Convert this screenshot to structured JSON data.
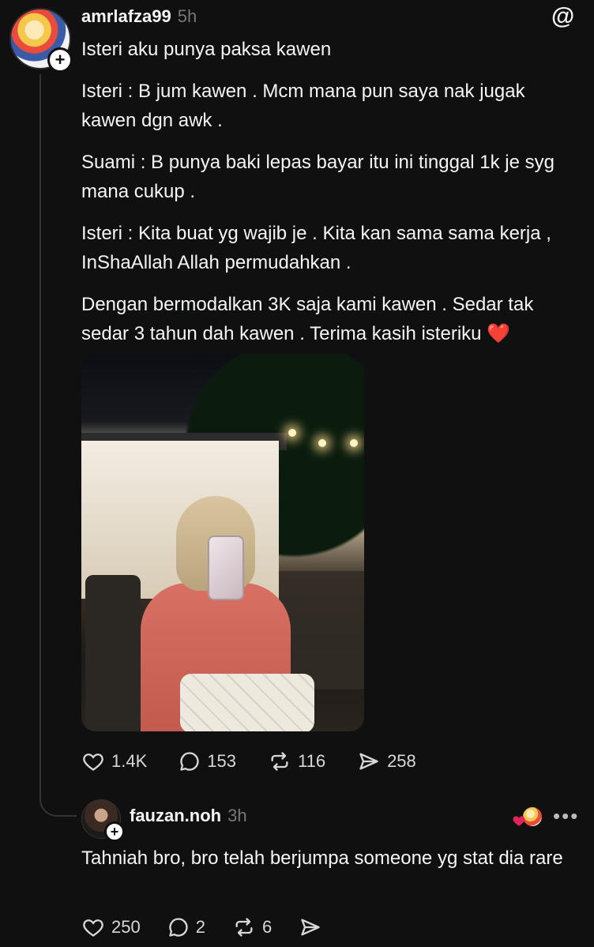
{
  "post": {
    "username": "amrlafza99",
    "time": "5h",
    "paragraphs": [
      "Isteri aku punya paksa kawen",
      "Isteri : B jum kawen . Mcm mana pun saya nak jugak kawen dgn awk .",
      "Suami : B punya baki lepas bayar itu ini tinggal 1k je syg mana cukup .",
      "Isteri : Kita buat yg wajib je . Kita kan sama sama kerja , InShaAllah Allah permudahkan .",
      "Dengan bermodalkan 3K saja kami kawen . Sedar tak sedar 3 tahun dah kawen . Terima kasih isteriku ❤️"
    ],
    "likes": "1.4K",
    "replies": "153",
    "reposts": "116",
    "shares": "258"
  },
  "reply": {
    "username": "fauzan.noh",
    "time": "3h",
    "text": "Tahniah bro, bro telah berjumpa someone yg stat dia rare",
    "likes": "250",
    "replies": "2",
    "reposts": "6"
  },
  "icons": {
    "app": "threads-logo-icon",
    "like": "heart-icon",
    "reply": "comment-icon",
    "repost": "repost-icon",
    "share": "send-icon",
    "more": "more-icon"
  },
  "colors": {
    "background": "#101010",
    "text": "#f3f5f7",
    "muted": "#777777",
    "heart": "#e0245e"
  }
}
